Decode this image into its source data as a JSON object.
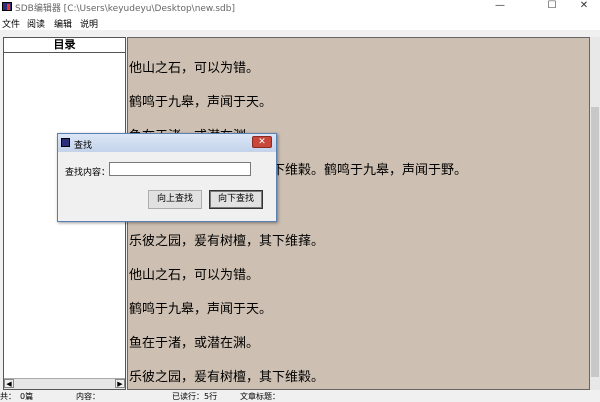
{
  "window": {
    "title": "SDB编辑器 [C:\\Users\\keyudeyu\\Desktop\\new.sdb]",
    "minimize_glyph": "—",
    "maximize_glyph": "☐",
    "close_glyph": "✕"
  },
  "menu": [
    "文件",
    "阅读",
    "编辑",
    "说明"
  ],
  "toc": {
    "header": "目录"
  },
  "content_lines": [
    "他山之石，可以为错。",
    "鹤鸣于九皋，声闻于天。",
    "鱼在于渚，或潜在渊。",
    "乐彼之园，爰有树檀，其下维榖。鹤鸣于九皋，声闻于野。",
    "乐彼之园，爰有树檀，其下维萚。",
    "他山之石，可以为错。",
    "鹤鸣于九皋，声闻于天。",
    "鱼在于渚，或潜在渊。",
    "乐彼之园，爰有树檀，其下维榖。"
  ],
  "status": {
    "a": "共：",
    "a_val": "0篇",
    "b": "内容：",
    "c": "已读行：5行",
    "d": "文章标题："
  },
  "dialog": {
    "title": "查找",
    "close_glyph": "✕",
    "label": "查找内容：",
    "input_value": "",
    "btn_up": "向上查找",
    "btn_down": "向下查找"
  }
}
